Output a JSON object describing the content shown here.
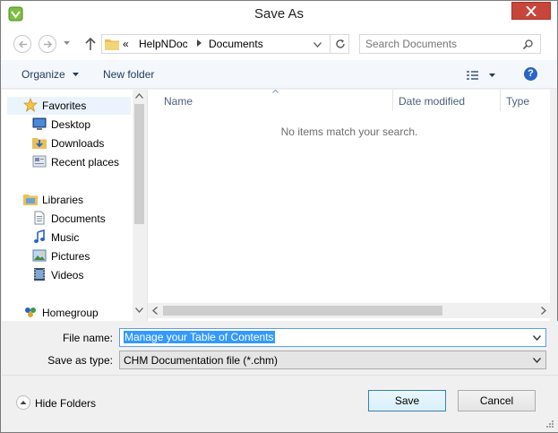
{
  "window": {
    "title": "Save As"
  },
  "address": {
    "overflow": "«",
    "crumbs": [
      "HelpNDoc",
      "Documents"
    ]
  },
  "search": {
    "placeholder": "Search Documents"
  },
  "toolbar": {
    "organize_label": "Organize",
    "new_folder_label": "New folder",
    "help_label": "?"
  },
  "nav": {
    "favorites": "Favorites",
    "desktop": "Desktop",
    "downloads": "Downloads",
    "recent": "Recent places",
    "libraries": "Libraries",
    "documents": "Documents",
    "music": "Music",
    "pictures": "Pictures",
    "videos": "Videos",
    "homegroup": "Homegroup"
  },
  "columns": {
    "name": "Name",
    "date": "Date modified",
    "type": "Type"
  },
  "content": {
    "empty_message": "No items match your search."
  },
  "form": {
    "file_name_label": "File name:",
    "file_name_value": "Manage your Table of Contents",
    "save_type_label": "Save as type:",
    "save_type_value": "CHM Documentation file  (*.chm)"
  },
  "footer": {
    "hide_folders_label": "Hide Folders",
    "save_label": "Save",
    "cancel_label": "Cancel"
  },
  "colors": {
    "accent": "#3399ff",
    "close": "#c7453b",
    "selection_bg": "#e5f3fb"
  },
  "icons": {
    "app": "app-icon",
    "close": "close-icon",
    "back": "back-arrow-icon",
    "forward": "forward-arrow-icon",
    "up": "up-arrow-icon",
    "folder": "folder-icon",
    "refresh": "refresh-icon",
    "search": "search-icon",
    "view": "view-options-icon",
    "help": "help-icon",
    "star": "star-icon",
    "desktop": "desktop-icon",
    "downloads": "downloads-icon",
    "recent": "recent-places-icon",
    "libraries": "libraries-icon",
    "documents": "documents-icon",
    "music": "music-icon",
    "pictures": "pictures-icon",
    "videos": "videos-icon",
    "homegroup": "homegroup-icon"
  }
}
